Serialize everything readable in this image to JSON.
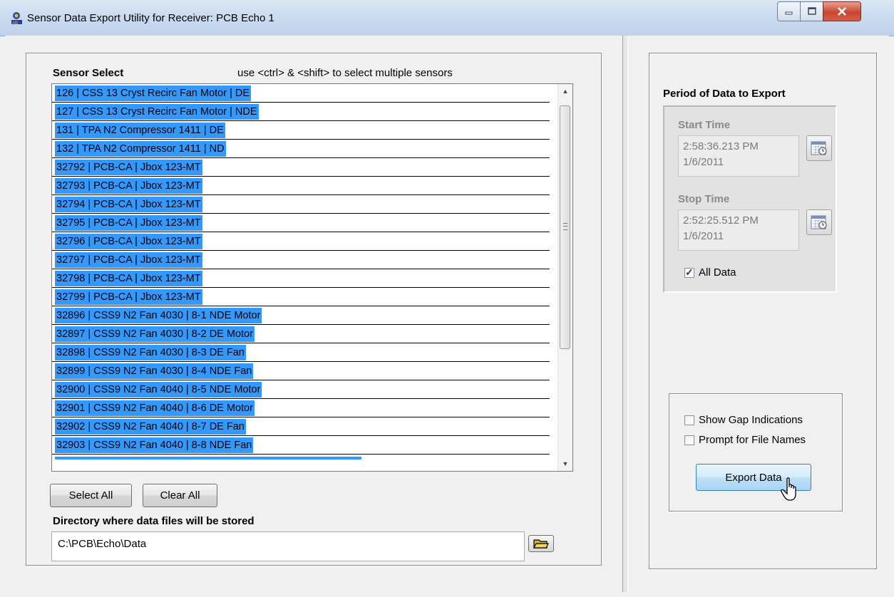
{
  "window": {
    "title": "Sensor Data Export Utility for Receiver: PCB Echo 1",
    "icon": "app-icon",
    "controls": {
      "minimize": "minimize-icon",
      "maximize": "maximize-icon",
      "close": "close-icon"
    }
  },
  "sensor_select": {
    "label": "Sensor Select",
    "hint": "use <ctrl> & <shift> to select multiple sensors",
    "items": [
      "126 | CSS 13 Cryst Recirc Fan Motor | DE",
      "127 | CSS 13 Cryst Recirc Fan Motor | NDE",
      "131 | TPA N2 Compressor 1411 | DE",
      "132 | TPA N2 Compressor 1411 | ND",
      "32792 | PCB-CA | Jbox 123-MT",
      "32793 | PCB-CA | Jbox 123-MT",
      "32794 | PCB-CA | Jbox 123-MT",
      "32795 | PCB-CA | Jbox 123-MT",
      "32796 | PCB-CA | Jbox 123-MT",
      "32797 | PCB-CA | Jbox 123-MT",
      "32798 | PCB-CA | Jbox 123-MT",
      "32799 | PCB-CA | Jbox 123-MT",
      "32896 | CSS9 N2 Fan 4030 | 8-1 NDE Motor",
      "32897 | CSS9 N2 Fan 4030 | 8-2 DE Motor",
      "32898 | CSS9 N2 Fan 4030 | 8-3 DE Fan",
      "32899 | CSS9 N2 Fan 4030 | 8-4 NDE Fan",
      "32900 | CSS9 N2 Fan 4040 | 8-5 NDE Motor",
      "32901 | CSS9 N2 Fan 4040 | 8-6 DE Motor",
      "32902 | CSS9 N2 Fan 4040 | 8-7 DE Fan",
      "32903 | CSS9 N2 Fan 4040 | 8-8 NDE Fan"
    ],
    "select_all_label": "Select All",
    "clear_all_label": "Clear All",
    "selection_color": "#3399ff"
  },
  "directory": {
    "label": "Directory where data files will be stored",
    "value": "C:\\PCB\\Echo\\Data",
    "browse_icon": "folder-icon"
  },
  "period": {
    "label": "Period of Data to Export",
    "start_label": "Start Time",
    "start_time": "2:58:36.213 PM",
    "start_date": "1/6/2011",
    "stop_label": "Stop Time",
    "stop_time": "2:52:25.512 PM",
    "stop_date": "1/6/2011",
    "all_data_label": "All Data",
    "all_data_checked": true,
    "calendar_icon": "calendar-icon"
  },
  "options": {
    "show_gap_label": "Show Gap Indications",
    "show_gap_checked": false,
    "prompt_names_label": "Prompt for File Names",
    "prompt_names_checked": false,
    "export_label": "Export Data"
  }
}
